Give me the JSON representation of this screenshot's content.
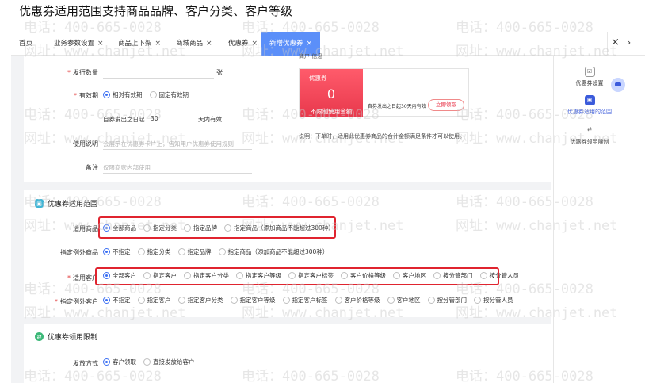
{
  "caption": "优惠券适用范围支持商品品牌、客户分类、客户等级",
  "tabs": [
    {
      "label": "首页"
    },
    {
      "label": "业务参数设置"
    },
    {
      "label": "商品上下架"
    },
    {
      "label": "商城商品"
    },
    {
      "label": "优惠券"
    },
    {
      "label": "新增优惠券",
      "active": true
    }
  ],
  "tab_close_symbol": "×",
  "tab_more_symbol": "›",
  "form": {
    "issue_qty": {
      "label": "发行数量",
      "unit": "张"
    },
    "validity": {
      "label": "有效期",
      "options": [
        "相对有效期",
        "固定有效期"
      ],
      "selected": 0,
      "prefix": "自券发出之日起",
      "days": "30",
      "suffix": "天内有效"
    },
    "usage": {
      "label": "使用说明",
      "placeholder": "会展示在优惠券卡片上，告知用户优惠券使用规则"
    },
    "remark": {
      "label": "备注",
      "placeholder": "仅限商家内部使用"
    }
  },
  "preview": {
    "partial_label": "商户·信息",
    "coupon_name": "优惠券",
    "amount": "0",
    "condition": "不限制使用金额",
    "valid_text": "自券发出之日起30天内有效",
    "claim_button": "立即领取",
    "note": "说明：下单时，适用此优惠券商品的合计金额满足条件才可以使用。"
  },
  "scope": {
    "title": "优惠券适用范围",
    "goods": {
      "label": "适用商品",
      "options": [
        "全部商品",
        "指定分类",
        "指定品牌",
        "指定商品（添加商品不能超过300种）"
      ],
      "selected": 0
    },
    "goods_exclude": {
      "label": "指定例外商品",
      "options": [
        "不指定",
        "指定分类",
        "指定品牌",
        "指定商品（添加商品不能超过300种）"
      ],
      "selected": 0
    },
    "customer": {
      "label": "适用客户",
      "options": [
        "全部客户",
        "指定客户",
        "指定客户分类",
        "指定客户等级",
        "指定客户标签",
        "客户价格等级",
        "客户地区",
        "按分管部门",
        "按分管人员"
      ],
      "selected": 0
    },
    "customer_exclude": {
      "label": "指定例外客户",
      "options": [
        "不指定",
        "指定客户",
        "指定客户分类",
        "指定客户等级",
        "指定客户标签",
        "客户价格等级",
        "客户地区",
        "按分管部门",
        "按分管人员"
      ],
      "selected": 0
    }
  },
  "limit": {
    "title": "优惠券领用限制",
    "issue_method": {
      "label": "发放方式",
      "options": [
        "客户领取",
        "直接发放给客户"
      ],
      "selected": 0
    }
  },
  "side_nav": [
    {
      "label": "优惠券设置",
      "icon": "settings-icon"
    },
    {
      "label": "优惠券适用的范围",
      "icon": "scope-icon",
      "active": true
    },
    {
      "label": "优惠券领用限制",
      "icon": "limit-icon"
    }
  ],
  "watermark": {
    "phone": "电话：400-665-0028",
    "site": "网址：www.chanjet.net"
  },
  "colors": {
    "accent": "#3b6ff3",
    "tab_active": "#5b8ff9",
    "coupon_red": "#e8384c",
    "highlight": "#e0242f"
  }
}
